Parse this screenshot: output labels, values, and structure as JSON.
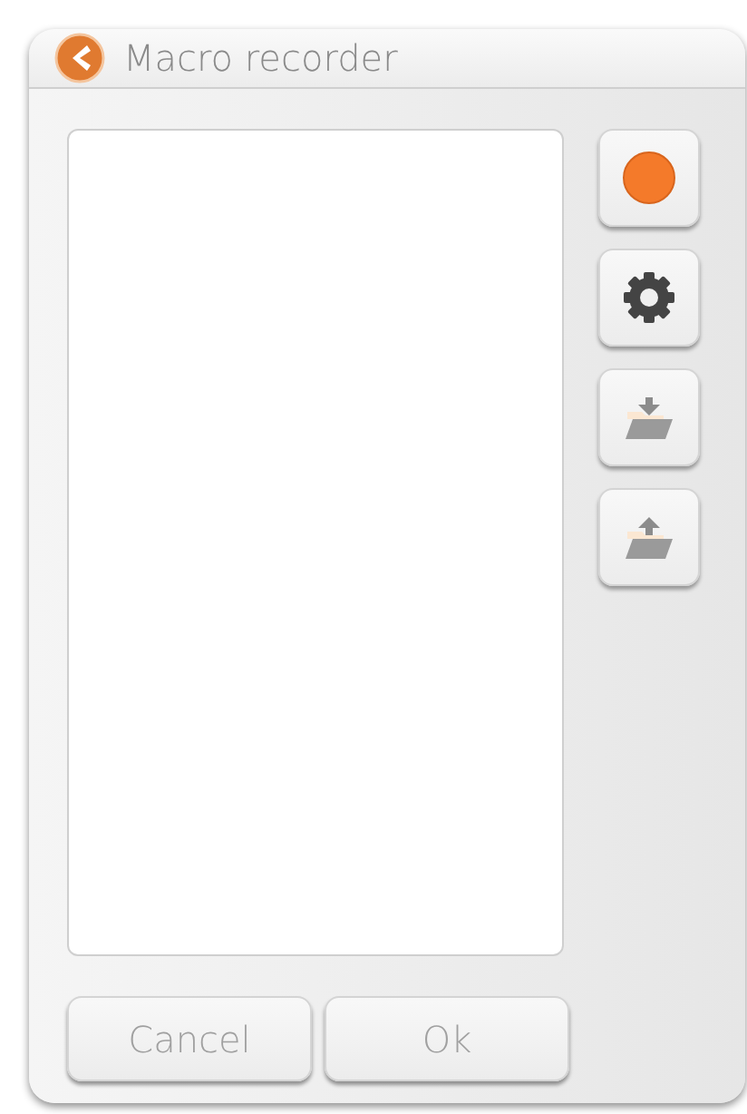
{
  "window": {
    "title": "Macro recorder"
  },
  "tools": [
    {
      "kind": "record"
    },
    {
      "kind": "settings"
    },
    {
      "kind": "import"
    },
    {
      "kind": "export"
    }
  ],
  "buttons": [
    "Cancel",
    "Ok"
  ]
}
